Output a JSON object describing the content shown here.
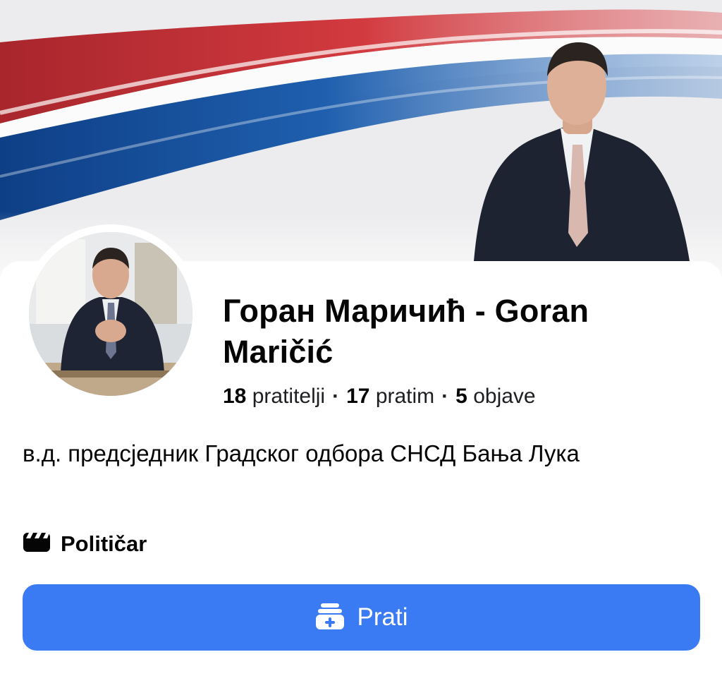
{
  "profile": {
    "name": "Горан Маричић - Goran Maričić",
    "stats": {
      "followers_count": "18",
      "followers_label": "pratitelji",
      "following_count": "17",
      "following_label": "pratim",
      "posts_count": "5",
      "posts_label": "objave",
      "separator": "·"
    },
    "bio": "в.д. предсједник Градског одбора СНСД Бања Лука",
    "category": {
      "icon": "clapperboard-icon",
      "label": "Političar"
    }
  },
  "actions": {
    "follow_label": "Prati",
    "follow_icon": "follow-add-icon"
  },
  "colors": {
    "button": "#3a7af2",
    "flag_red": "#c6363c",
    "flag_blue": "#0c4076",
    "flag_white": "#ffffff"
  }
}
